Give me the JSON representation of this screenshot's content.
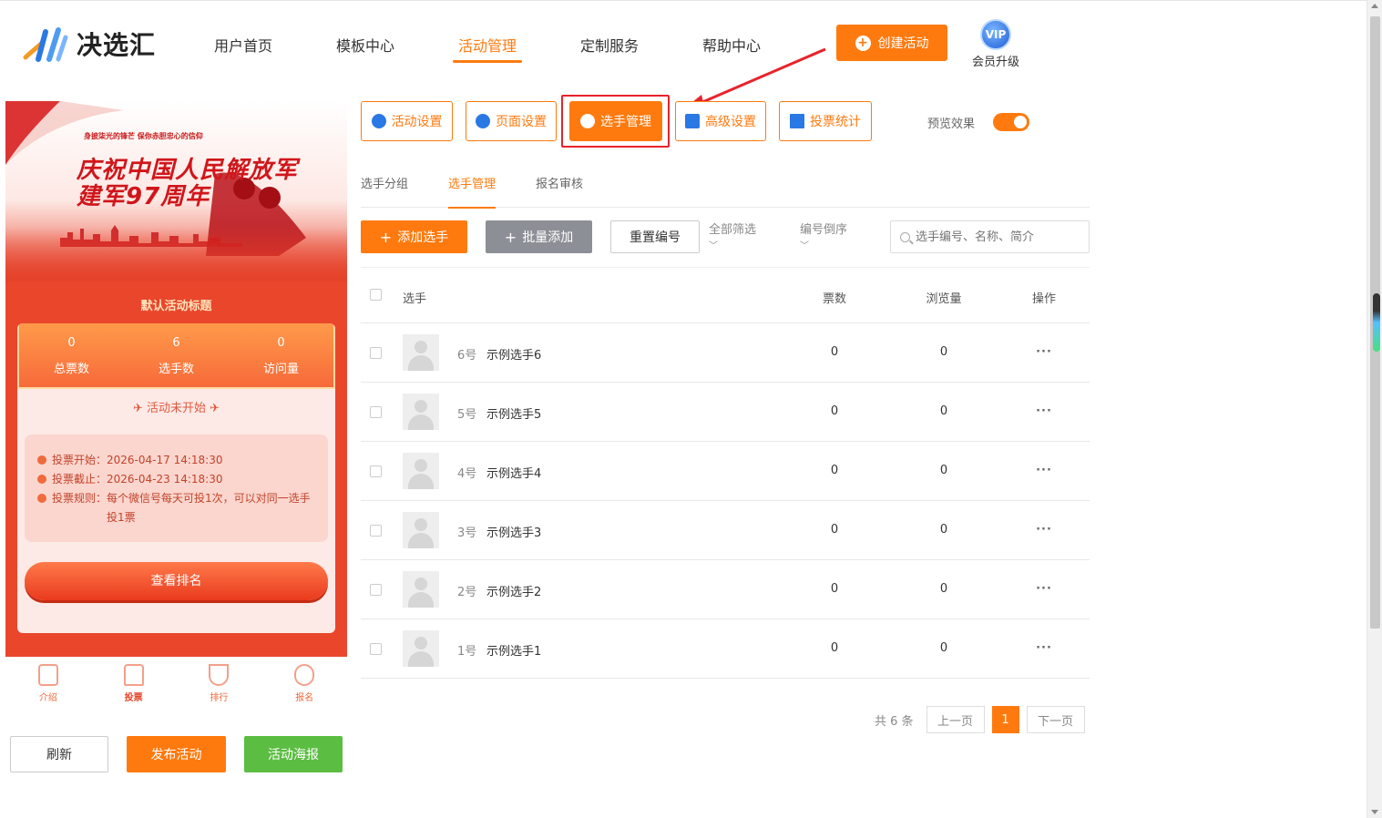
{
  "app": {
    "logo_text": "决选汇",
    "nav": [
      "用户首页",
      "模板中心",
      "活动管理",
      "定制服务",
      "帮助中心"
    ],
    "nav_active_index": 2,
    "create_label": "创建活动",
    "vip_badge": "VIP",
    "vip_label": "会员升级"
  },
  "preview": {
    "banner_small": "身披柒光的锋芒 保你赤胆忠心的信仰",
    "banner_title_1": "庆祝中国人民解放军",
    "banner_title_2": "建军97周年",
    "activity_title": "默认活动标题",
    "stats": [
      {
        "value": "0",
        "label": "总票数"
      },
      {
        "value": "6",
        "label": "选手数"
      },
      {
        "value": "0",
        "label": "访问量"
      }
    ],
    "status": "活动未开始",
    "info": [
      {
        "label": "投票开始：",
        "value": "2026-04-17 14:18:30"
      },
      {
        "label": "投票截止：",
        "value": "2026-04-23 14:18:30"
      },
      {
        "label": "投票规则：",
        "value": "每个微信号每天可投1次，可以对同一选手投1票"
      }
    ],
    "rank_button": "查看排名",
    "tabs": [
      "介绍",
      "投票",
      "排行",
      "报名"
    ],
    "tab_active_index": 1
  },
  "bottom_buttons": {
    "refresh": "刷新",
    "publish": "发布活动",
    "poster": "活动海报"
  },
  "settings_tabs": [
    "活动设置",
    "页面设置",
    "选手管理",
    "高级设置",
    "投票统计"
  ],
  "settings_active_index": 2,
  "preview_toggle_label": "预览效果",
  "preview_toggle_on": true,
  "subtabs": [
    "选手分组",
    "选手管理",
    "报名审核"
  ],
  "subtab_active_index": 1,
  "toolbar": {
    "add": "添加选手",
    "batch": "批量添加",
    "reset": "重置编号",
    "filter": "全部筛选",
    "sort": "编号倒序",
    "search_placeholder": "选手编号、名称、简介"
  },
  "table": {
    "headers": {
      "player": "选手",
      "votes": "票数",
      "views": "浏览量",
      "ops": "操作"
    },
    "rows": [
      {
        "num": "6号",
        "name": "示例选手6",
        "votes": "0",
        "views": "0"
      },
      {
        "num": "5号",
        "name": "示例选手5",
        "votes": "0",
        "views": "0"
      },
      {
        "num": "4号",
        "name": "示例选手4",
        "votes": "0",
        "views": "0"
      },
      {
        "num": "3号",
        "name": "示例选手3",
        "votes": "0",
        "views": "0"
      },
      {
        "num": "2号",
        "name": "示例选手2",
        "votes": "0",
        "views": "0"
      },
      {
        "num": "1号",
        "name": "示例选手1",
        "votes": "0",
        "views": "0"
      }
    ],
    "ops_symbol": "···"
  },
  "pager": {
    "total": "共 6 条",
    "prev": "上一页",
    "current": "1",
    "next": "下一页"
  },
  "colors": {
    "accent": "#ff7a0e",
    "highlight_box": "#e8232b",
    "poster_green": "#5cbd43",
    "batch_gray": "#8c8f95"
  }
}
